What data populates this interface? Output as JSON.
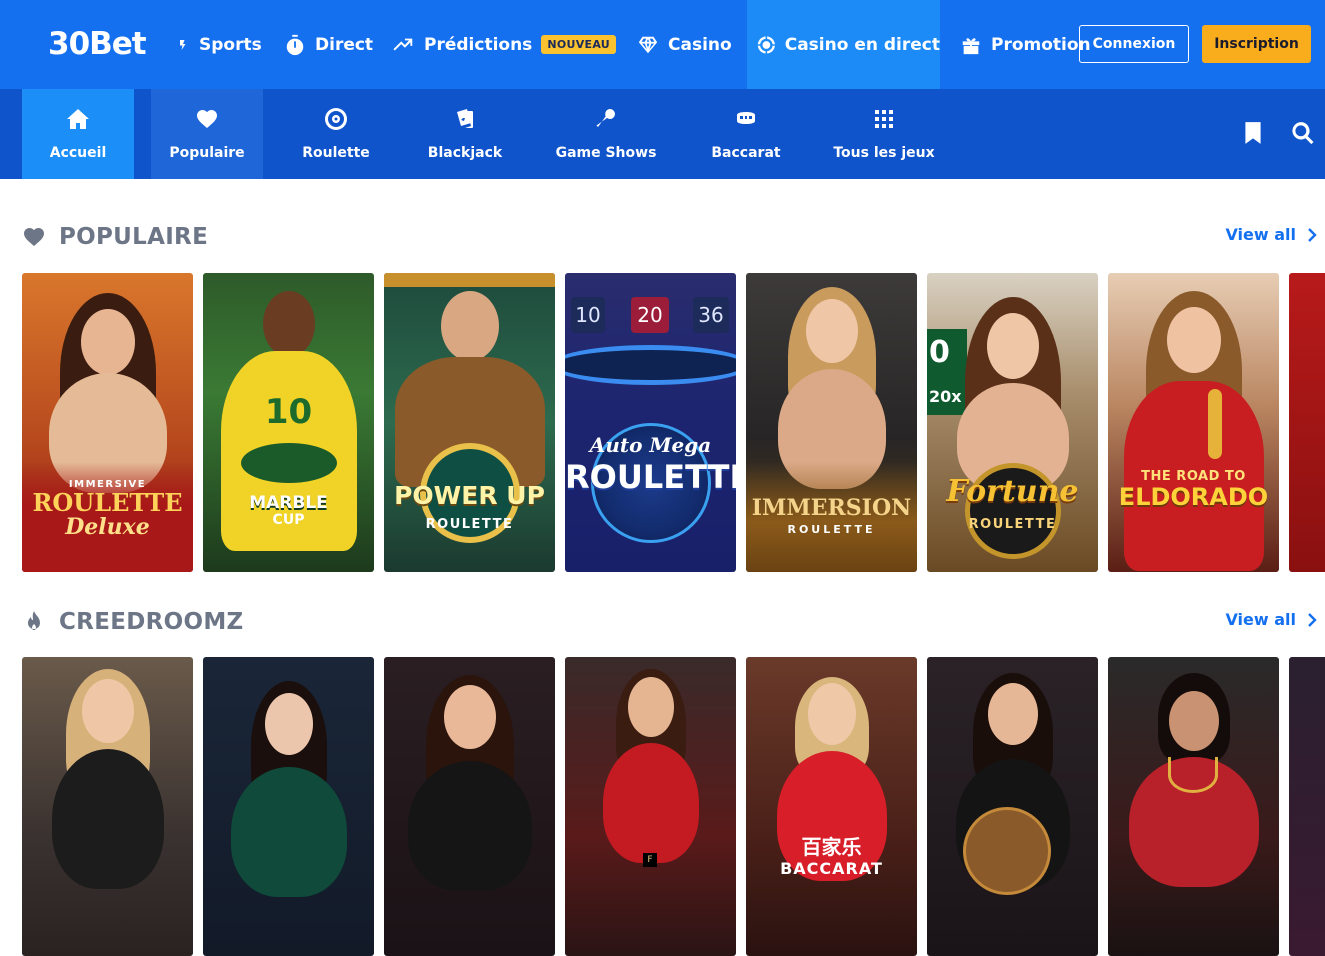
{
  "brand": {
    "name": "30Bet"
  },
  "topnav": {
    "items": [
      {
        "label": "Sports",
        "icon": "sports-icon"
      },
      {
        "label": "Direct",
        "icon": "stopwatch-icon"
      },
      {
        "label": "Prédictions",
        "icon": "trend-up-icon",
        "badge": "NOUVEAU"
      },
      {
        "label": "Casino",
        "icon": "diamond-icon"
      },
      {
        "label": "Casino en direct",
        "icon": "roulette-chip-icon",
        "active": true
      },
      {
        "label": "Promotion",
        "icon": "gift-icon"
      }
    ],
    "login_label": "Connexion",
    "signup_label": "Inscription"
  },
  "subnav": {
    "items": [
      {
        "label": "Accueil",
        "icon": "home-icon"
      },
      {
        "label": "Populaire",
        "icon": "heart-icon"
      },
      {
        "label": "Roulette",
        "icon": "roulette-icon"
      },
      {
        "label": "Blackjack",
        "icon": "cards-icon"
      },
      {
        "label": "Game Shows",
        "icon": "microphone-icon"
      },
      {
        "label": "Baccarat",
        "icon": "baccarat-table-icon"
      },
      {
        "label": "Tous les jeux",
        "icon": "grid-icon"
      }
    ],
    "bookmark_icon": "bookmark-icon",
    "search_icon": "search-icon"
  },
  "sections": [
    {
      "title": "POPULAIRE",
      "icon": "heart-icon",
      "view_all": "View all",
      "cards": [
        {
          "name": "Immersive Roulette Deluxe",
          "line1": "IMMERSIVE",
          "line2": "ROULETTE",
          "line3": "Deluxe"
        },
        {
          "name": "Marble Cup Ronaldinho",
          "line1": "10",
          "line2": "MARBLE",
          "line3": "CUP"
        },
        {
          "name": "Power Up Roulette",
          "line1": "POWER UP",
          "line2": "ROULETTE"
        },
        {
          "name": "Auto Mega Roulette",
          "line1": "Auto Mega",
          "line2": "ROULETTE",
          "n1": "10",
          "n2": "20",
          "n3": "36"
        },
        {
          "name": "Immersion Roulette",
          "line1": "IMMERSION",
          "line2": "ROULETTE"
        },
        {
          "name": "Fortune Roulette",
          "line1": "Fortune",
          "line2": "ROULETTE",
          "n1": "0",
          "n2": "20x"
        },
        {
          "name": "The Road to Eldorado",
          "line1": "THE ROAD TO",
          "line2": "ELDORADO"
        }
      ]
    },
    {
      "title": "CREEDROOMZ",
      "icon": "flame-icon",
      "view_all": "View all",
      "cards": [
        {
          "name": "Live dealer 1"
        },
        {
          "name": "Live dealer 2"
        },
        {
          "name": "Live dealer 3"
        },
        {
          "name": "Live dealer 4",
          "line1": "F"
        },
        {
          "name": "Baccarat dealer",
          "line1": "百家乐",
          "line2": "BACCARAT"
        },
        {
          "name": "Live dealer 6"
        },
        {
          "name": "Live dealer 7"
        }
      ]
    }
  ],
  "colors": {
    "topbar": "#1570f0",
    "subbar": "#1054cc",
    "accent": "#f9ad1c",
    "link": "#1570f0",
    "section_title": "#6d7686"
  }
}
